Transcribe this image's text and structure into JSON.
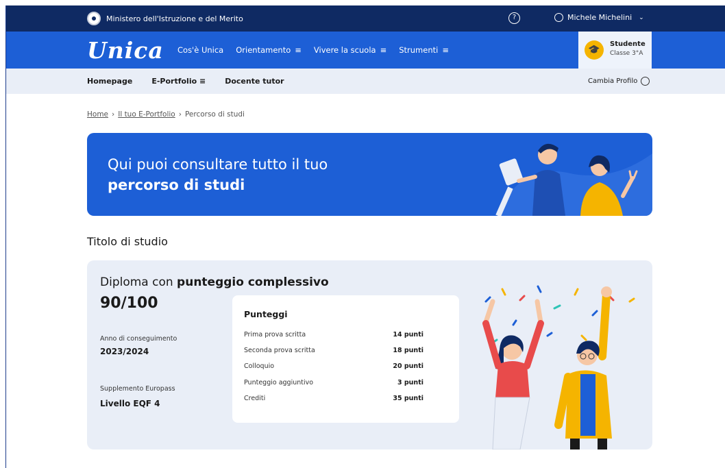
{
  "topbar": {
    "ministry": "Ministero dell'Istruzione e del Merito",
    "user_name": "Michele Michelini"
  },
  "mainnav": {
    "logo": "Unica",
    "links": [
      {
        "label": "Cos'è Unica",
        "menu": false
      },
      {
        "label": "Orientamento",
        "menu": true
      },
      {
        "label": "Vivere la scuola",
        "menu": true
      },
      {
        "label": "Strumenti",
        "menu": true
      }
    ],
    "profile": {
      "role": "Studente",
      "class": "Classe 3°A"
    }
  },
  "subnav": {
    "links": [
      "Homepage",
      "E-Portfolio",
      "Docente tutor"
    ],
    "change_profile": "Cambia Profilo"
  },
  "breadcrumb": [
    "Home",
    "Il tuo E-Portfolio",
    "Percorso di studi"
  ],
  "hero": {
    "line1": "Qui puoi consultare tutto il tuo",
    "line2": "percorso di studi"
  },
  "section_title": "Titolo di studio",
  "diploma": {
    "title_prefix": "Diploma con",
    "title_bold": "punteggio complessivo",
    "score": "90/100",
    "year_label": "Anno di conseguimento",
    "year_value": "2023/2024",
    "supplement_label": "Supplemento Europass",
    "supplement_value": "Livello EQF 4"
  },
  "scores": {
    "title": "Punteggi",
    "rows": [
      {
        "label": "Prima prova scritta",
        "value": "14 punti"
      },
      {
        "label": "Seconda prova scritta",
        "value": "18 punti"
      },
      {
        "label": "Colloquio",
        "value": "20 punti"
      },
      {
        "label": "Punteggio aggiuntivo",
        "value": "3 punti"
      },
      {
        "label": "Crediti",
        "value": "35 punti"
      }
    ]
  },
  "colors": {
    "navy": "#0f2a63",
    "primary": "#1d5fd6",
    "light": "#e9eef7",
    "accent": "#f5b400"
  }
}
